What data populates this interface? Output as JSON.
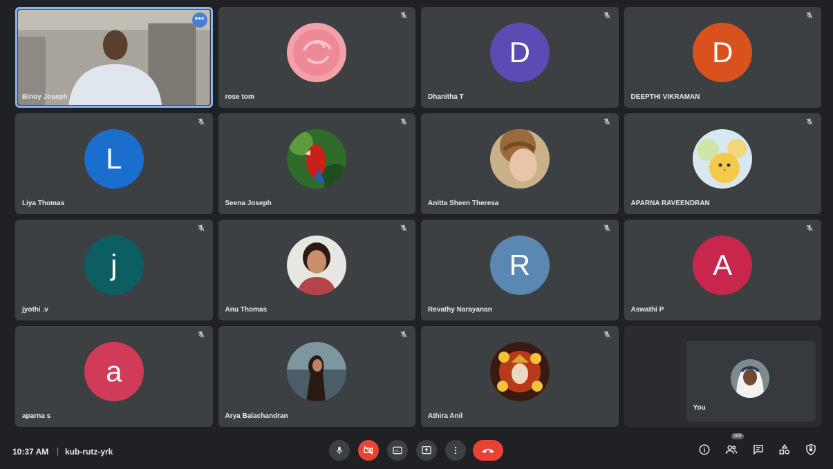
{
  "participants": [
    {
      "name": "Binoy Joseph",
      "type": "video",
      "active": true
    },
    {
      "name": "rose tom",
      "type": "photo",
      "photo": "rose",
      "muted": true
    },
    {
      "name": "Dhanitha T",
      "type": "initial",
      "initial": "D",
      "color": "#5c4bb5",
      "muted": true
    },
    {
      "name": "DEEPTHI VIKRAMAN",
      "type": "initial",
      "initial": "D",
      "color": "#d9521e",
      "muted": true
    },
    {
      "name": "Liya Thomas",
      "type": "initial",
      "initial": "L",
      "color": "#1a6fce",
      "muted": true
    },
    {
      "name": "Seena Joseph",
      "type": "photo",
      "photo": "parrot",
      "muted": true
    },
    {
      "name": "Anitta Sheen Theresa",
      "type": "photo",
      "photo": "girl",
      "muted": true
    },
    {
      "name": "APARNA RAVEENDRAN",
      "type": "photo",
      "photo": "chick",
      "muted": true
    },
    {
      "name": "jyothi .v",
      "type": "initial",
      "initial": "j",
      "color": "#0d5e63",
      "muted": true
    },
    {
      "name": "Anu Thomas",
      "type": "photo",
      "photo": "woman",
      "muted": true
    },
    {
      "name": "Revathy Narayanan",
      "type": "initial",
      "initial": "R",
      "color": "#5a88b3",
      "muted": true
    },
    {
      "name": "Aswathi P",
      "type": "initial",
      "initial": "A",
      "color": "#c9264e",
      "muted": true
    },
    {
      "name": "aparna s",
      "type": "initial",
      "initial": "a",
      "color": "#d23b57",
      "muted": true
    },
    {
      "name": "Arya Balachandran",
      "type": "photo",
      "photo": "lake",
      "muted": true
    },
    {
      "name": "Athira Anil",
      "type": "photo",
      "photo": "krishna",
      "muted": true
    },
    {
      "name": "You",
      "type": "self",
      "photo": "nun"
    }
  ],
  "colors": {
    "tile_bg": "#3c4043",
    "page_bg": "#1f2124",
    "active_border": "#8ab4f8",
    "danger": "#ea4335"
  },
  "bottombar": {
    "time": "10:37 AM",
    "separator": "|",
    "meeting_code": "kub-rutz-yrk",
    "controls": [
      "mic-icon",
      "camera-off-icon",
      "captions-icon",
      "present-icon",
      "more-options-icon",
      "hang-up-icon"
    ],
    "right_icons": [
      "info-icon",
      "people-icon",
      "chat-icon",
      "activities-icon",
      "host-controls-icon"
    ],
    "people_badge": "100"
  }
}
